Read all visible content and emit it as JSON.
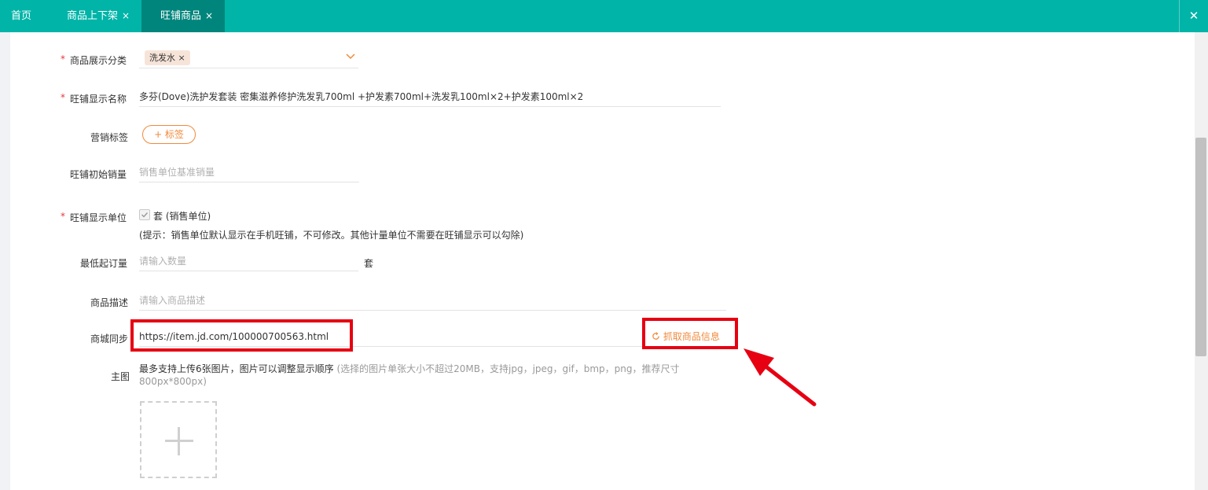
{
  "tabs": [
    {
      "label": "首页",
      "closable": false,
      "active": false
    },
    {
      "label": "商品上下架",
      "closable": true,
      "active": false
    },
    {
      "label": "旺铺商品",
      "closable": true,
      "active": true
    }
  ],
  "tab_close_glyph": "×",
  "window_close_glyph": "✕",
  "form": {
    "required_mark": "*",
    "category": {
      "label": "商品展示分类",
      "chip": "洗发水",
      "chip_remove": "×"
    },
    "display_name": {
      "label": "旺铺显示名称",
      "value": "多芬(Dove)洗护发套装 密集滋养修护洗发乳700ml +护发素700ml+洗发乳100ml×2+护发素100ml×2"
    },
    "marketing_tag": {
      "label": "营销标签",
      "button": "+ 标签"
    },
    "initial_sales": {
      "label": "旺铺初始销量",
      "placeholder": "销售单位基准销量"
    },
    "display_unit": {
      "label": "旺铺显示单位",
      "checkbox_label": "套 (销售单位)",
      "checked": true,
      "hint": "(提示：销售单位默认显示在手机旺铺，不可修改。其他计量单位不需要在旺铺显示可以勾除)"
    },
    "min_order": {
      "label": "最低起订量",
      "placeholder": "请输入数量",
      "unit": "套"
    },
    "description": {
      "label": "商品描述",
      "placeholder": "请输入商品描述"
    },
    "mall_sync": {
      "label": "商城同步",
      "value": "https://item.jd.com/100000700563.html",
      "fetch_button": "抓取商品信息"
    },
    "main_image": {
      "label": "主图",
      "hint_main": "最多支持上传6张图片，图片可以调整显示顺序",
      "hint_detail_1": "(选择的图片单张大小不超过20MB，支持jpg，jpeg，gif，bmp，png，推荐尺寸",
      "hint_detail_2": "800px*800px)"
    }
  },
  "icons": {
    "chevron": "chevron-down-icon",
    "check": "check-icon",
    "refresh": "refresh-icon",
    "plus": "plus-icon",
    "close": "close-icon"
  },
  "colors": {
    "topbar": "#00b4a8",
    "active_tab": "#00857c",
    "accent_orange": "#f08a3c",
    "required_red": "#e4393c",
    "annotation_red": "#e60012"
  }
}
